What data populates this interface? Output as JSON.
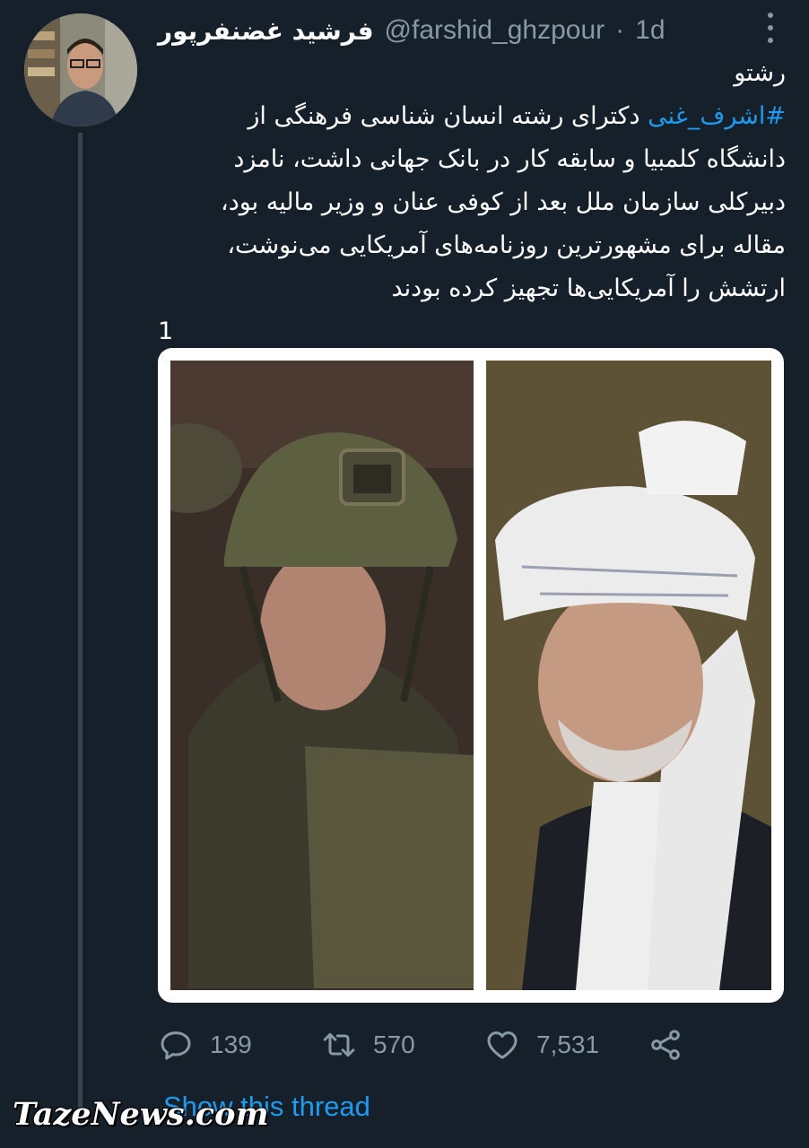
{
  "tweet": {
    "display_name": "فرشید غضنفرپور",
    "handle": "@farshid_ghzpour",
    "separator": "·",
    "time": "1d",
    "text_lines": [
      "رشتو",
      "#اشرف_غنی دکترای رشته انسان شناسی فرهنگی از",
      "دانشگاه کلمبیا و سابقه کار در بانک جهانی داشت، نامزد",
      "دبیرکلی سازمان ملل بعد از کوفی عنان و وزیر مالیه بود،",
      "مقاله برای مشهورترین روزنامه‌های آمریکایی می‌نوشت،",
      "ارتشش را آمریکایی‌ها تجهیز کرده بودند",
      "1"
    ],
    "hashtag": "#اشرف_غنی",
    "line1_rest": " دکترای رشته انسان شناسی فرهنگی از"
  },
  "actions": {
    "reply_count": "139",
    "retweet_count": "570",
    "like_count": "7,531"
  },
  "show_thread": "Show this thread",
  "watermark": "TazeNews.com",
  "icons": [
    "more-vertical-icon",
    "reply-icon",
    "retweet-icon",
    "like-icon",
    "share-icon"
  ],
  "colors": {
    "background": "#15202b",
    "accent": "#1d9bf0",
    "muted": "#8899a6"
  }
}
